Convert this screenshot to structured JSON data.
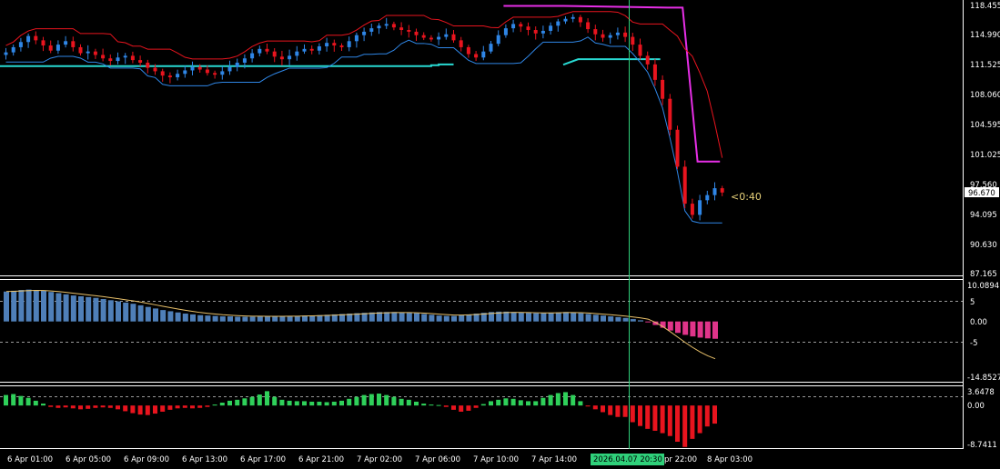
{
  "colors": {
    "background": "#000000",
    "bull": "#2f86e6",
    "bear": "#e8141e",
    "upper_band": "#e8141e",
    "lower_band": "#2f86e6",
    "support_line": "#28d9d2",
    "resistance_line": "#e62ee6",
    "crosshair": "#2fd07a",
    "osc_bar": "#4f7fb8",
    "osc_bar_neg": "#e0348a",
    "osc_signal": "#e8c06a",
    "hist_pos": "#2fd05a",
    "hist_neg": "#e8141e",
    "price_tag_bg": "#ffffff",
    "time_tag_bg": "#2fd07a"
  },
  "price_axis": {
    "ticks": [
      "118.455",
      "114.990",
      "111.525",
      "108.060",
      "104.595",
      "101.025",
      "97.560",
      "94.095",
      "90.630",
      "87.165"
    ],
    "current_price": "96.670",
    "countdown": "<0:40"
  },
  "oscillator_axis": {
    "ticks": [
      "10.0894",
      "5",
      "0.00",
      "-5",
      "-14.8527"
    ]
  },
  "histogram_axis": {
    "ticks": [
      "3.6478",
      "0.00",
      "-8.7411"
    ]
  },
  "time_axis": {
    "labels": [
      "6 Apr 01:00",
      "6 Apr 05:00",
      "6 Apr 09:00",
      "6 Apr 13:00",
      "6 Apr 17:00",
      "6 Apr 21:00",
      "7 Apr 02:00",
      "7 Apr 06:00",
      "7 Apr 10:00",
      "7 Apr 14:00",
      "2026.04.07 20:30",
      "pr 22:00",
      "8 Apr 03:00"
    ]
  },
  "chart_data": [
    {
      "type": "candlestick",
      "panel": "price",
      "ylim": [
        87.165,
        118.455
      ],
      "series": [
        {
          "name": "",
          "close_path": [
            113.0,
            113.6,
            114.2,
            114.9,
            114.4,
            113.8,
            113.2,
            113.9,
            114.3,
            113.6,
            112.9,
            113.1,
            112.7,
            112.3,
            112.0,
            112.4,
            112.6,
            112.1,
            111.8,
            111.2,
            110.8,
            110.3,
            110.1,
            110.5,
            110.9,
            111.3,
            111.0,
            110.6,
            110.4,
            110.8,
            111.3,
            111.8,
            112.3,
            112.9,
            113.4,
            113.1,
            112.5,
            112.2,
            112.6,
            113.1,
            113.4,
            113.2,
            113.7,
            114.1,
            113.8,
            113.6,
            114.3,
            115.0,
            115.4,
            115.8,
            116.1,
            116.3,
            115.9,
            115.6,
            115.4,
            115.0,
            114.7,
            114.5,
            114.8,
            115.1,
            114.4,
            113.6,
            112.8,
            112.4,
            113.1,
            114.0,
            115.0,
            115.8,
            116.3,
            116.0,
            115.6,
            115.2,
            115.5,
            116.1,
            116.6,
            116.9,
            117.1,
            116.5,
            115.7,
            115.1,
            114.7,
            115.0,
            115.3,
            114.8,
            113.9,
            112.6,
            111.6,
            109.8,
            107.6,
            104.0,
            99.7,
            95.4,
            94.1,
            95.8,
            96.4,
            97.2,
            96.7
          ]
        }
      ]
    },
    {
      "type": "bar",
      "panel": "oscillator",
      "ylim": [
        -14.8527,
        10.0894
      ],
      "series": [
        {
          "name": "",
          "values": [
            7.6,
            7.8,
            8.0,
            8.1,
            8.0,
            7.8,
            7.5,
            7.2,
            6.9,
            6.6,
            6.4,
            6.2,
            6.0,
            5.7,
            5.4,
            5.1,
            4.8,
            4.5,
            4.1,
            3.7,
            3.3,
            2.9,
            2.6,
            2.3,
            2.0,
            1.8,
            1.6,
            1.5,
            1.4,
            1.3,
            1.3,
            1.2,
            1.2,
            1.2,
            1.3,
            1.3,
            1.3,
            1.3,
            1.4,
            1.4,
            1.5,
            1.5,
            1.6,
            1.7,
            1.8,
            1.9,
            2.0,
            2.1,
            2.2,
            2.3,
            2.4,
            2.4,
            2.4,
            2.3,
            2.2,
            2.1,
            1.9,
            1.7,
            1.5,
            1.4,
            1.4,
            1.6,
            1.8,
            2.0,
            2.2,
            2.4,
            2.5,
            2.5,
            2.4,
            2.3,
            2.2,
            2.1,
            2.1,
            2.2,
            2.3,
            2.4,
            2.3,
            2.1,
            1.9,
            1.7,
            1.5,
            1.3,
            1.1,
            0.9,
            0.6,
            0.3,
            -0.2,
            -0.9,
            -1.6,
            -2.3,
            -2.9,
            -3.4,
            -3.8,
            -4.1,
            -4.3,
            -4.4
          ]
        }
      ]
    },
    {
      "type": "bar",
      "panel": "histogram",
      "ylim": [
        -8.7411,
        3.6478
      ],
      "series": [
        {
          "name": "",
          "values": [
            2.2,
            2.4,
            2.0,
            1.6,
            1.0,
            0.4,
            -0.3,
            -0.5,
            -0.4,
            -0.6,
            -0.8,
            -0.7,
            -0.5,
            -0.4,
            -0.5,
            -0.8,
            -1.2,
            -1.6,
            -1.9,
            -2.0,
            -1.7,
            -1.3,
            -0.9,
            -0.6,
            -0.5,
            -0.6,
            -0.5,
            -0.3,
            0.2,
            0.6,
            1.0,
            1.2,
            1.5,
            1.8,
            2.3,
            3.0,
            1.8,
            1.2,
            1.0,
            0.9,
            0.9,
            0.8,
            0.8,
            0.7,
            0.8,
            1.0,
            1.4,
            1.8,
            2.2,
            2.4,
            2.5,
            2.2,
            1.8,
            1.4,
            1.2,
            0.8,
            0.4,
            0.2,
            0.1,
            -0.3,
            -0.9,
            -1.3,
            -1.1,
            -0.5,
            0.3,
            0.9,
            1.2,
            1.5,
            1.4,
            1.1,
            0.9,
            0.9,
            1.6,
            2.2,
            2.6,
            2.8,
            2.2,
            0.9,
            -0.2,
            -0.8,
            -1.4,
            -2.0,
            -2.4,
            -2.4,
            -3.5,
            -4.3,
            -4.9,
            -5.3,
            -5.8,
            -6.4,
            -7.6,
            -8.7,
            -7.0,
            -5.8,
            -4.4,
            -3.8
          ]
        }
      ]
    }
  ]
}
